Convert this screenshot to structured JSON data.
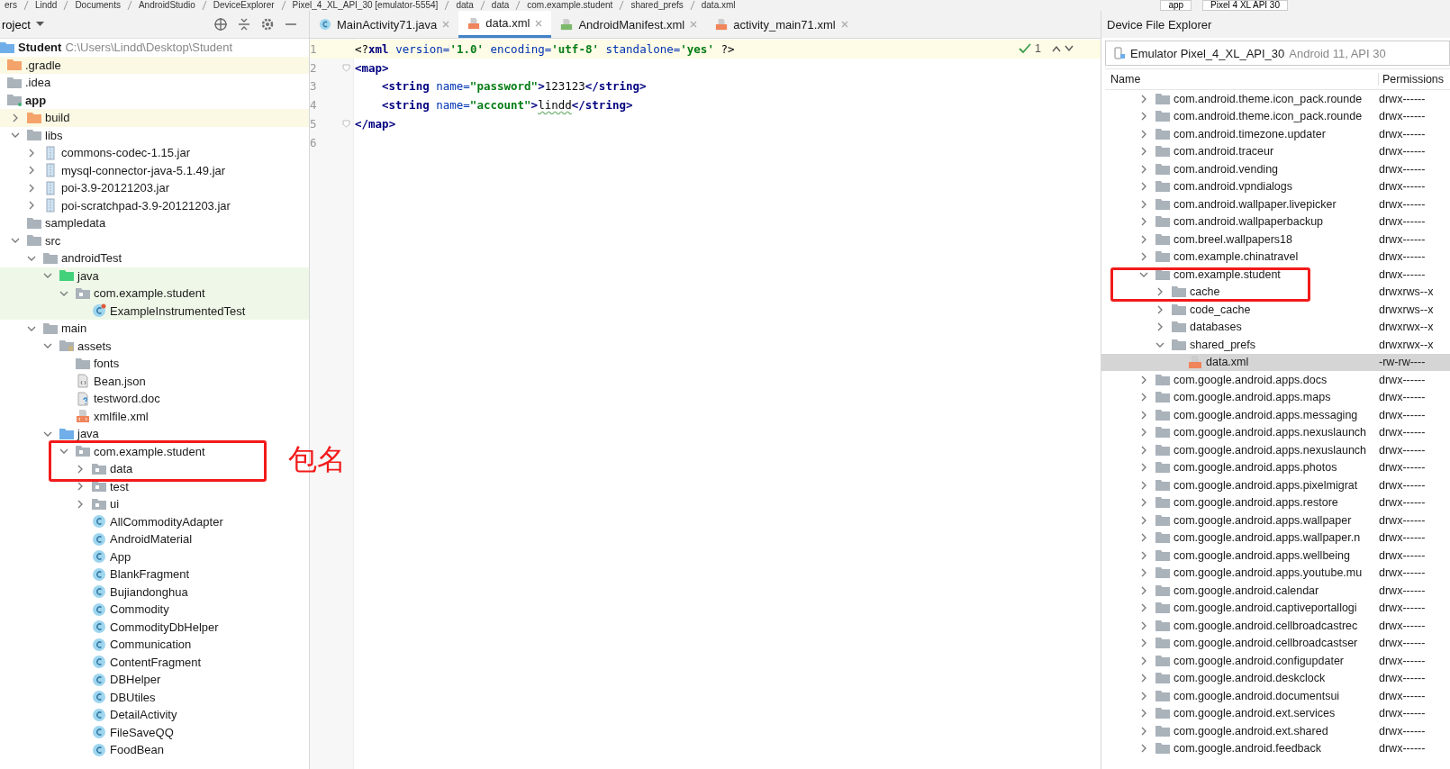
{
  "breadcrumb": [
    "ers",
    "Lindd",
    "Documents",
    "AndroidStudio",
    "DeviceExplorer",
    "Pixel_4_XL_API_30 [emulator-5554]",
    "data",
    "data",
    "com.example.student",
    "shared_prefs",
    "data.xml"
  ],
  "run_config": {
    "module": "app",
    "device": "Pixel 4 XL API 30"
  },
  "project": {
    "view": "roject",
    "root": {
      "name": "Student",
      "path": "C:\\Users\\Lindd\\Desktop\\Student"
    },
    "tree": [
      {
        "name": ".gradle",
        "kind": "excluded"
      },
      {
        "name": ".idea",
        "kind": "folder"
      },
      {
        "name": "app",
        "kind": "module",
        "children": [
          {
            "name": "build",
            "kind": "excluded",
            "expanded": false
          },
          {
            "name": "libs",
            "kind": "folder",
            "expanded": true,
            "children": [
              {
                "name": "commons-codec-1.15.jar",
                "kind": "jar",
                "expanded": false
              },
              {
                "name": "mysql-connector-java-5.1.49.jar",
                "kind": "jar",
                "expanded": false
              },
              {
                "name": "poi-3.9-20121203.jar",
                "kind": "jar",
                "expanded": false
              },
              {
                "name": "poi-scratchpad-3.9-20121203.jar",
                "kind": "jar",
                "expanded": false
              }
            ]
          },
          {
            "name": "sampledata",
            "kind": "folder"
          },
          {
            "name": "src",
            "kind": "folder",
            "expanded": true,
            "children": [
              {
                "name": "androidTest",
                "kind": "folder",
                "expanded": true,
                "children": [
                  {
                    "name": "java",
                    "kind": "test_source",
                    "expanded": true,
                    "in_test": true,
                    "children": [
                      {
                        "name": "com.example.student",
                        "kind": "package",
                        "expanded": true,
                        "in_test": true,
                        "children": [
                          {
                            "name": "ExampleInstrumentedTest",
                            "kind": "test_class",
                            "in_test": true
                          }
                        ]
                      }
                    ]
                  }
                ]
              },
              {
                "name": "main",
                "kind": "folder",
                "expanded": true,
                "children": [
                  {
                    "name": "assets",
                    "kind": "assets",
                    "expanded": true,
                    "children": [
                      {
                        "name": "fonts",
                        "kind": "folder"
                      },
                      {
                        "name": "Bean.json",
                        "kind": "json"
                      },
                      {
                        "name": "testword.doc",
                        "kind": "doc"
                      },
                      {
                        "name": "xmlfile.xml",
                        "kind": "xml"
                      }
                    ]
                  },
                  {
                    "name": "java",
                    "kind": "source",
                    "expanded": true,
                    "children": [
                      {
                        "name": "com.example.student",
                        "kind": "package",
                        "expanded": true,
                        "children": [
                          {
                            "name": "data",
                            "kind": "package",
                            "expanded": false
                          },
                          {
                            "name": "test",
                            "kind": "package",
                            "expanded": false
                          },
                          {
                            "name": "ui",
                            "kind": "package",
                            "expanded": false
                          },
                          {
                            "name": "AllCommodityAdapter",
                            "kind": "class"
                          },
                          {
                            "name": "AndroidMaterial",
                            "kind": "class"
                          },
                          {
                            "name": "App",
                            "kind": "class"
                          },
                          {
                            "name": "BlankFragment",
                            "kind": "class"
                          },
                          {
                            "name": "Bujiandonghua",
                            "kind": "class"
                          },
                          {
                            "name": "Commodity",
                            "kind": "class"
                          },
                          {
                            "name": "CommodityDbHelper",
                            "kind": "class"
                          },
                          {
                            "name": "Communication",
                            "kind": "class"
                          },
                          {
                            "name": "ContentFragment",
                            "kind": "class"
                          },
                          {
                            "name": "DBHelper",
                            "kind": "class"
                          },
                          {
                            "name": "DBUtiles",
                            "kind": "class"
                          },
                          {
                            "name": "DetailActivity",
                            "kind": "class"
                          },
                          {
                            "name": "FileSaveQQ",
                            "kind": "class"
                          },
                          {
                            "name": "FoodBean",
                            "kind": "class"
                          }
                        ]
                      }
                    ]
                  }
                ]
              }
            ]
          }
        ]
      }
    ]
  },
  "editor": {
    "tabs": [
      {
        "label": "MainActivity71.java",
        "kind": "java",
        "selected": false
      },
      {
        "label": "data.xml",
        "kind": "xml",
        "selected": true
      },
      {
        "label": "AndroidManifest.xml",
        "kind": "manifest",
        "selected": false
      },
      {
        "label": "activity_main71.xml",
        "kind": "xml",
        "selected": false
      }
    ],
    "inspection": "1",
    "lines": [
      {
        "number": "1",
        "current": true,
        "fold": false,
        "tokens": [
          {
            "kind": "bracket",
            "text": "<?"
          },
          {
            "kind": "tag",
            "text": "xml "
          },
          {
            "kind": "attr",
            "text": "version="
          },
          {
            "kind": "value",
            "text": "'1.0' "
          },
          {
            "kind": "attr",
            "text": "encoding="
          },
          {
            "kind": "value",
            "text": "'utf-8' "
          },
          {
            "kind": "attr",
            "text": "standalone="
          },
          {
            "kind": "value",
            "text": "'yes' "
          },
          {
            "kind": "bracket",
            "text": "?>"
          }
        ]
      },
      {
        "number": "2",
        "current": false,
        "fold": true,
        "tokens": [
          {
            "kind": "tag",
            "text": "<map>"
          }
        ]
      },
      {
        "number": "3",
        "current": false,
        "fold": false,
        "indent": true,
        "tokens": [
          {
            "kind": "tag",
            "text": "<string "
          },
          {
            "kind": "attr",
            "text": "name="
          },
          {
            "kind": "value",
            "text": "\"password\""
          },
          {
            "kind": "tag",
            "text": ">"
          },
          {
            "kind": "text",
            "text": "123123"
          },
          {
            "kind": "tag",
            "text": "</string>"
          }
        ]
      },
      {
        "number": "4",
        "current": false,
        "fold": false,
        "indent": true,
        "tokens": [
          {
            "kind": "tag",
            "text": "<string "
          },
          {
            "kind": "attr",
            "text": "name="
          },
          {
            "kind": "value",
            "text": "\"account\""
          },
          {
            "kind": "tag",
            "text": ">"
          },
          {
            "kind": "typo",
            "text": "lindd"
          },
          {
            "kind": "tag",
            "text": "</string>"
          }
        ]
      },
      {
        "number": "5",
        "current": false,
        "fold": true,
        "tokens": [
          {
            "kind": "tag",
            "text": "</map>"
          }
        ]
      },
      {
        "number": "6",
        "current": false,
        "fold": false
      }
    ]
  },
  "annotation": "包名",
  "device_explorer": {
    "title": "Device File Explorer",
    "device": "Emulator Pixel_4_XL_API_30",
    "device_detail": "Android 11, API 30",
    "columns": [
      "Name",
      "Permissions"
    ],
    "files": [
      {
        "name": "com.android.theme.icon_pack.rounde",
        "permissions": "drwx------",
        "kind": "folder",
        "expanded": false,
        "selected": false
      },
      {
        "name": "com.android.theme.icon_pack.rounde",
        "permissions": "drwx------",
        "kind": "folder",
        "expanded": false,
        "selected": false
      },
      {
        "name": "com.android.timezone.updater",
        "permissions": "drwx------",
        "kind": "folder",
        "expanded": false,
        "selected": false
      },
      {
        "name": "com.android.traceur",
        "permissions": "drwx------",
        "kind": "folder",
        "expanded": false,
        "selected": false
      },
      {
        "name": "com.android.vending",
        "permissions": "drwx------",
        "kind": "folder",
        "expanded": false,
        "selected": false
      },
      {
        "name": "com.android.vpndialogs",
        "permissions": "drwx------",
        "kind": "folder",
        "expanded": false,
        "selected": false
      },
      {
        "name": "com.android.wallpaper.livepicker",
        "permissions": "drwx------",
        "kind": "folder",
        "expanded": false,
        "selected": false
      },
      {
        "name": "com.android.wallpaperbackup",
        "permissions": "drwx------",
        "kind": "folder",
        "expanded": false,
        "selected": false
      },
      {
        "name": "com.breel.wallpapers18",
        "permissions": "drwx------",
        "kind": "folder",
        "expanded": false,
        "selected": false
      },
      {
        "name": "com.example.chinatravel",
        "permissions": "drwx------",
        "kind": "folder",
        "expanded": false,
        "selected": false
      },
      {
        "name": "com.example.student",
        "permissions": "drwx------",
        "kind": "folder",
        "expanded": true,
        "selected": false,
        "children": [
          {
            "name": "cache",
            "permissions": "drwxrws--x",
            "kind": "folder",
            "expanded": false,
            "selected": false
          },
          {
            "name": "code_cache",
            "permissions": "drwxrws--x",
            "kind": "folder",
            "expanded": false,
            "selected": false
          },
          {
            "name": "databases",
            "permissions": "drwxrwx--x",
            "kind": "folder",
            "expanded": false,
            "selected": false
          },
          {
            "name": "shared_prefs",
            "permissions": "drwxrwx--x",
            "kind": "folder",
            "expanded": true,
            "selected": false,
            "children": [
              {
                "name": "data.xml",
                "permissions": "-rw-rw----",
                "kind": "xml",
                "selected": true
              }
            ]
          }
        ]
      },
      {
        "name": "com.google.android.apps.docs",
        "permissions": "drwx------",
        "kind": "folder",
        "expanded": false,
        "selected": false
      },
      {
        "name": "com.google.android.apps.maps",
        "permissions": "drwx------",
        "kind": "folder",
        "expanded": false,
        "selected": false
      },
      {
        "name": "com.google.android.apps.messaging",
        "permissions": "drwx------",
        "kind": "folder",
        "expanded": false,
        "selected": false
      },
      {
        "name": "com.google.android.apps.nexuslaunch",
        "permissions": "drwx------",
        "kind": "folder",
        "expanded": false,
        "selected": false
      },
      {
        "name": "com.google.android.apps.nexuslaunch",
        "permissions": "drwx------",
        "kind": "folder",
        "expanded": false,
        "selected": false
      },
      {
        "name": "com.google.android.apps.photos",
        "permissions": "drwx------",
        "kind": "folder",
        "expanded": false,
        "selected": false
      },
      {
        "name": "com.google.android.apps.pixelmigrat",
        "permissions": "drwx------",
        "kind": "folder",
        "expanded": false,
        "selected": false
      },
      {
        "name": "com.google.android.apps.restore",
        "permissions": "drwx------",
        "kind": "folder",
        "expanded": false,
        "selected": false
      },
      {
        "name": "com.google.android.apps.wallpaper",
        "permissions": "drwx------",
        "kind": "folder",
        "expanded": false,
        "selected": false
      },
      {
        "name": "com.google.android.apps.wallpaper.n",
        "permissions": "drwx------",
        "kind": "folder",
        "expanded": false,
        "selected": false
      },
      {
        "name": "com.google.android.apps.wellbeing",
        "permissions": "drwx------",
        "kind": "folder",
        "expanded": false,
        "selected": false
      },
      {
        "name": "com.google.android.apps.youtube.mu",
        "permissions": "drwx------",
        "kind": "folder",
        "expanded": false,
        "selected": false
      },
      {
        "name": "com.google.android.calendar",
        "permissions": "drwx------",
        "kind": "folder",
        "expanded": false,
        "selected": false
      },
      {
        "name": "com.google.android.captiveportallogi",
        "permissions": "drwx------",
        "kind": "folder",
        "expanded": false,
        "selected": false
      },
      {
        "name": "com.google.android.cellbroadcastrec",
        "permissions": "drwx------",
        "kind": "folder",
        "expanded": false,
        "selected": false
      },
      {
        "name": "com.google.android.cellbroadcastser",
        "permissions": "drwx------",
        "kind": "folder",
        "expanded": false,
        "selected": false
      },
      {
        "name": "com.google.android.configupdater",
        "permissions": "drwx------",
        "kind": "folder",
        "expanded": false,
        "selected": false
      },
      {
        "name": "com.google.android.deskclock",
        "permissions": "drwx------",
        "kind": "folder",
        "expanded": false,
        "selected": false
      },
      {
        "name": "com.google.android.documentsui",
        "permissions": "drwx------",
        "kind": "folder",
        "expanded": false,
        "selected": false
      },
      {
        "name": "com.google.android.ext.services",
        "permissions": "drwx------",
        "kind": "folder",
        "expanded": false,
        "selected": false
      },
      {
        "name": "com.google.android.ext.shared",
        "permissions": "drwx------",
        "kind": "folder",
        "expanded": false,
        "selected": false
      },
      {
        "name": "com.google.android.feedback",
        "permissions": "drwx------",
        "kind": "folder",
        "expanded": false,
        "selected": false
      }
    ]
  }
}
